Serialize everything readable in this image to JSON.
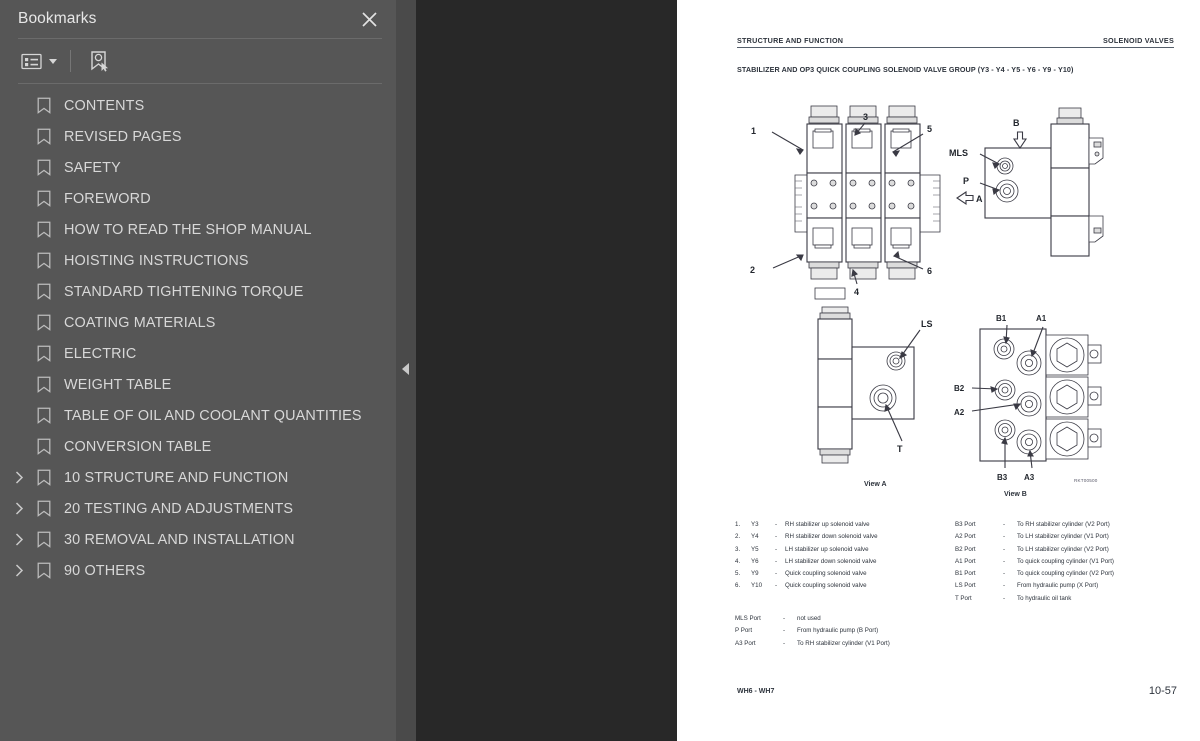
{
  "sidebar": {
    "title": "Bookmarks",
    "close_icon": "close-icon",
    "toolbar": {
      "list_options_label": "list-options-icon",
      "new_bookmark_label": "new-bookmark-icon"
    },
    "items": [
      {
        "label": "CONTENTS",
        "expandable": false
      },
      {
        "label": "REVISED PAGES",
        "expandable": false
      },
      {
        "label": "SAFETY",
        "expandable": false
      },
      {
        "label": "FOREWORD",
        "expandable": false
      },
      {
        "label": "HOW TO READ THE SHOP MANUAL",
        "expandable": false
      },
      {
        "label": "HOISTING INSTRUCTIONS",
        "expandable": false
      },
      {
        "label": "STANDARD TIGHTENING TORQUE",
        "expandable": false
      },
      {
        "label": "COATING MATERIALS",
        "expandable": false
      },
      {
        "label": "ELECTRIC",
        "expandable": false
      },
      {
        "label": "WEIGHT TABLE",
        "expandable": false
      },
      {
        "label": "TABLE OF OIL AND COOLANT QUANTITIES",
        "expandable": false
      },
      {
        "label": "CONVERSION TABLE",
        "expandable": false
      },
      {
        "label": "10 STRUCTURE AND FUNCTION",
        "expandable": true
      },
      {
        "label": "20 TESTING AND ADJUSTMENTS",
        "expandable": true
      },
      {
        "label": "30 REMOVAL AND INSTALLATION",
        "expandable": true
      },
      {
        "label": "90 OTHERS",
        "expandable": true
      }
    ]
  },
  "splitter": {
    "collapse_icon": "collapse-left-arrow-icon"
  },
  "page": {
    "header_left": "STRUCTURE AND FUNCTION",
    "header_right": "SOLENOID VALVES",
    "subtitle": "STABILIZER AND OP3 QUICK COUPLING SOLENOID VALVE GROUP (Y3 - Y4 - Y5 - Y6 - Y9 - Y10)",
    "figure_callouts": [
      "1",
      "2",
      "3",
      "4",
      "5",
      "6"
    ],
    "figure_port_labels_top": [
      "MLS",
      "P",
      "A",
      "B"
    ],
    "view_a": {
      "caption": "View A",
      "labels": [
        "LS",
        "T"
      ]
    },
    "view_b": {
      "caption": "View B",
      "labels": [
        "B1",
        "A1",
        "B2",
        "A2",
        "B3",
        "A3"
      ],
      "refcode": "RKT00500"
    },
    "legend_items": [
      {
        "num": "1.",
        "code": "Y3",
        "dash": "-",
        "text": "RH stabilizer up solenoid valve"
      },
      {
        "num": "2.",
        "code": "Y4",
        "dash": "-",
        "text": "RH stabilizer down solenoid valve"
      },
      {
        "num": "3.",
        "code": "Y5",
        "dash": "-",
        "text": "LH stabilizer up solenoid valve"
      },
      {
        "num": "4.",
        "code": "Y6",
        "dash": "-",
        "text": "LH stabilizer down solenoid valve"
      },
      {
        "num": "5.",
        "code": "Y9",
        "dash": "-",
        "text": "Quick coupling solenoid valve"
      },
      {
        "num": "6.",
        "code": "Y10",
        "dash": "-",
        "text": "Quick coupling solenoid valve"
      }
    ],
    "legend_ports_left": [
      {
        "key": "MLS Port",
        "dash": "-",
        "text": "not used"
      },
      {
        "key": "P Port",
        "dash": "-",
        "text": "From hydraulic pump (B Port)"
      },
      {
        "key": "A3 Port",
        "dash": "-",
        "text": "To RH stabilizer cylinder (V1 Port)"
      }
    ],
    "legend_ports_right": [
      {
        "key": "B3 Port",
        "dash": "-",
        "text": "To RH stabilizer cylinder (V2 Port)"
      },
      {
        "key": "A2 Port",
        "dash": "-",
        "text": "To LH stabilizer cylinder (V1 Port)"
      },
      {
        "key": "B2 Port",
        "dash": "-",
        "text": "To LH stabilizer cylinder (V2 Port)"
      },
      {
        "key": "A1 Port",
        "dash": "-",
        "text": "To quick coupling cylinder (V1 Port)"
      },
      {
        "key": "B1 Port",
        "dash": "-",
        "text": "To quick coupling cylinder (V2 Port)"
      },
      {
        "key": "LS Port",
        "dash": "-",
        "text": "From hydraulic pump (X Port)"
      },
      {
        "key": "T Port",
        "dash": "-",
        "text": "To hydraulic oil tank"
      }
    ],
    "footer_left": "WH6 - WH7",
    "footer_right": "10-57"
  },
  "colors": {
    "sidebar_bg": "#565656",
    "splitter_bg": "#4a4a4a",
    "doc_bg": "#282828",
    "page_bg": "#ffffff",
    "text": "#d8d8d8",
    "rule": "#555f6b"
  }
}
